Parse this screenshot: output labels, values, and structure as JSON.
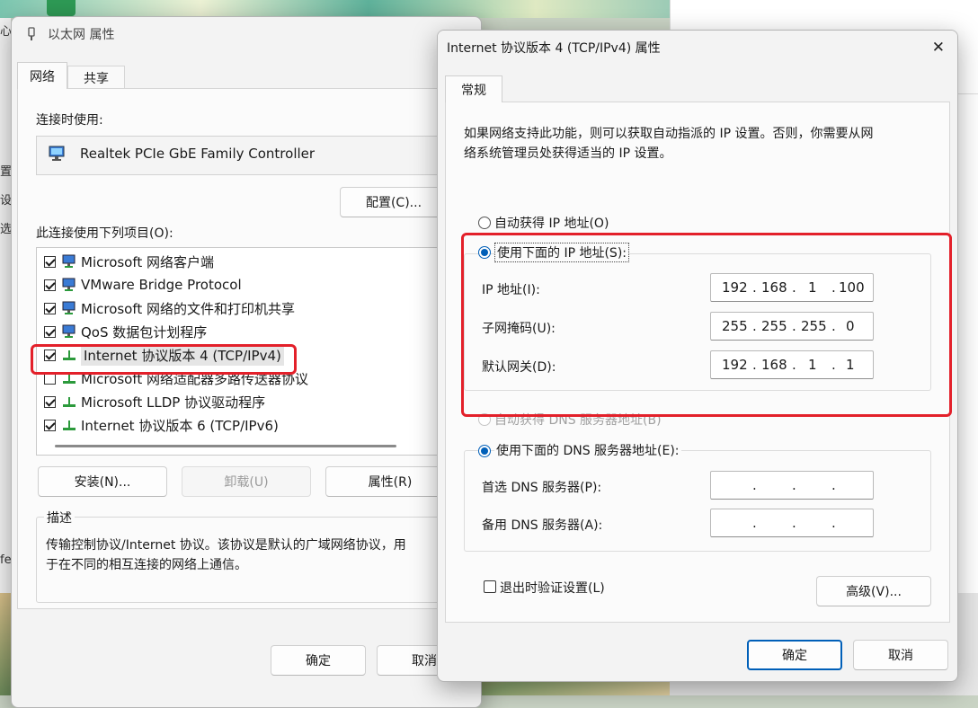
{
  "background": {
    "left_strip_chars": [
      "心",
      "置",
      "设",
      "选",
      "fe"
    ]
  },
  "ethernet_window": {
    "title": "以太网 属性",
    "tabs": [
      {
        "label": "网络",
        "active": true
      },
      {
        "label": "共享",
        "active": false
      }
    ],
    "connect_using_label": "连接时使用:",
    "adapter_name": "Realtek PCIe GbE Family Controller",
    "configure_button": "配置(C)...",
    "items_label": "此连接使用下列项目(O):",
    "items": [
      {
        "label": "Microsoft 网络客户端",
        "checked": true,
        "icon": "network-client-icon"
      },
      {
        "label": "VMware Bridge Protocol",
        "checked": true,
        "icon": "network-client-icon"
      },
      {
        "label": "Microsoft 网络的文件和打印机共享",
        "checked": true,
        "icon": "network-client-icon"
      },
      {
        "label": "QoS 数据包计划程序",
        "checked": true,
        "icon": "network-client-icon"
      },
      {
        "label": "Internet 协议版本 4 (TCP/IPv4)",
        "checked": true,
        "icon": "protocol-icon"
      },
      {
        "label": "Microsoft 网络适配器多路传送器协议",
        "checked": false,
        "icon": "protocol-icon"
      },
      {
        "label": "Microsoft LLDP 协议驱动程序",
        "checked": true,
        "icon": "protocol-icon"
      },
      {
        "label": "Internet 协议版本 6 (TCP/IPv6)",
        "checked": true,
        "icon": "protocol-icon"
      }
    ],
    "install_button": "安装(N)...",
    "uninstall_button": "卸载(U)",
    "properties_button": "属性(R)",
    "description_label": "描述",
    "description_text_line1": "传输控制协议/Internet 协议。该协议是默认的广域网络协议，用",
    "description_text_line2": "于在不同的相互连接的网络上通信。",
    "ok_button": "确定",
    "cancel_button": "取消"
  },
  "ipv4_window": {
    "title": "Internet 协议版本 4 (TCP/IPv4) 属性",
    "close_glyph": "✕",
    "tab_general": "常规",
    "intro_line1": "如果网络支持此功能，则可以获取自动指派的 IP 设置。否则，你需要从网",
    "intro_line2": "络系统管理员处获得适当的 IP 设置。",
    "auto_ip_label": "自动获得 IP 地址(O)",
    "manual_ip_label": "使用下面的 IP 地址(S):",
    "ip_address_label": "IP 地址(I):",
    "ip_address": [
      "192",
      "168",
      "1",
      "100"
    ],
    "subnet_label": "子网掩码(U):",
    "subnet": [
      "255",
      "255",
      "255",
      "0"
    ],
    "gateway_label": "默认网关(D):",
    "gateway": [
      "192",
      "168",
      "1",
      "1"
    ],
    "auto_dns_label": "自动获得 DNS 服务器地址(B)",
    "manual_dns_label": "使用下面的 DNS 服务器地址(E):",
    "preferred_dns_label": "首选 DNS 服务器(P):",
    "alternate_dns_label": "备用 DNS 服务器(A):",
    "validate_label": "退出时验证设置(L)",
    "advanced_button": "高级(V)...",
    "ok_button": "确定",
    "cancel_button": "取消",
    "dot": "."
  },
  "annotation_color": "#e3202a"
}
